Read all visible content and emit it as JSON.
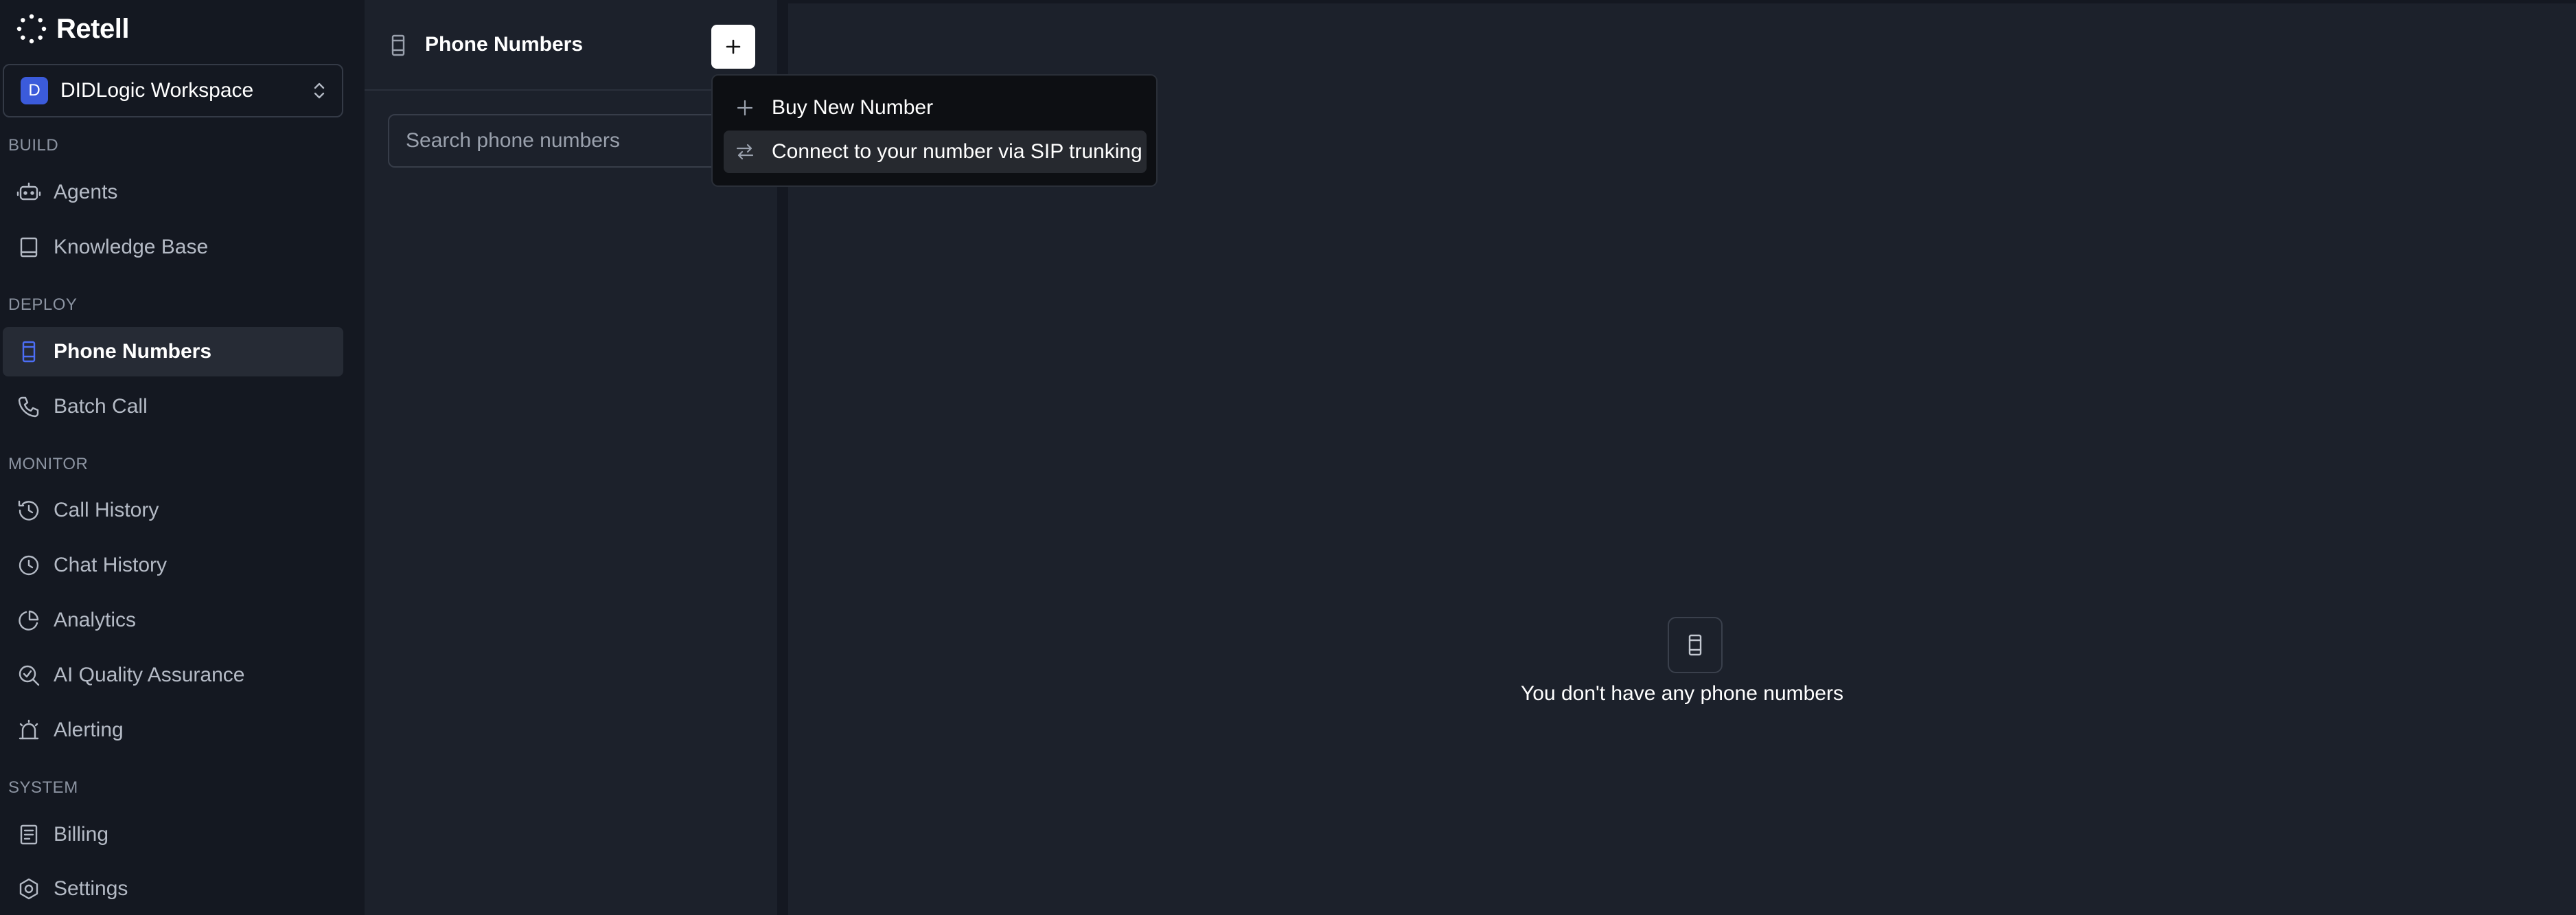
{
  "brand": {
    "name": "Retell"
  },
  "workspace": {
    "initial": "D",
    "name": "DIDLogic Workspace"
  },
  "sidebar": {
    "sections": [
      {
        "label": "BUILD"
      },
      {
        "label": "DEPLOY"
      },
      {
        "label": "MONITOR"
      },
      {
        "label": "SYSTEM"
      }
    ],
    "items": [
      {
        "label": "Agents",
        "icon": "robot-icon"
      },
      {
        "label": "Knowledge Base",
        "icon": "book-icon"
      },
      {
        "label": "Phone Numbers",
        "icon": "phone-number-icon",
        "active": true
      },
      {
        "label": "Batch Call",
        "icon": "phone-icon"
      },
      {
        "label": "Call History",
        "icon": "history-icon"
      },
      {
        "label": "Chat History",
        "icon": "clock-icon"
      },
      {
        "label": "Analytics",
        "icon": "pie-chart-icon"
      },
      {
        "label": "AI Quality Assurance",
        "icon": "search-check-icon"
      },
      {
        "label": "Alerting",
        "icon": "alarm-icon"
      },
      {
        "label": "Billing",
        "icon": "receipt-icon"
      },
      {
        "label": "Settings",
        "icon": "gear-icon"
      }
    ]
  },
  "panel": {
    "title": "Phone Numbers",
    "search_placeholder": "Search phone numbers"
  },
  "menu": {
    "items": [
      {
        "label": "Buy New Number",
        "icon": "plus-icon"
      },
      {
        "label": "Connect to your number via SIP trunking",
        "icon": "arrows-swap-icon"
      }
    ]
  },
  "main": {
    "empty_text": "You don't have any phone numbers"
  },
  "colors": {
    "background": "#141821",
    "panel": "#1c212b",
    "active_item": "#262b35",
    "accent": "#3b5bdb",
    "menu_bg": "#0d0f13"
  }
}
